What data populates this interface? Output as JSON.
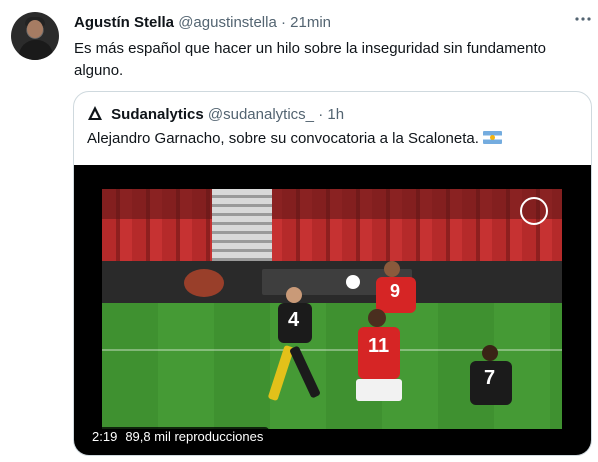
{
  "tweet": {
    "author_name": "Agustín Stella",
    "handle": "@agustinstella",
    "separator": "·",
    "time": "21min",
    "more_icon": "more-horizontal-icon",
    "text": "Es más español que hacer un hilo sobre la inseguridad sin fundamento alguno."
  },
  "quote": {
    "author_name": "Sudanalytics",
    "handle": "@sudanalytics_",
    "separator": "·",
    "time": "1h",
    "logo_icon": "triangle-logo-icon",
    "text": "Alejandro Garnacho, sobre su convocatoria a la Scaloneta.",
    "flag_icon": "argentina-flag-icon",
    "video": {
      "duration": "2:19",
      "views": "89,8 mil reproducciones",
      "jersey_numbers": [
        "4",
        "9",
        "11",
        "7"
      ]
    }
  },
  "colors": {
    "text_primary": "#0f1419",
    "text_secondary": "#536471",
    "border": "#cfd9de"
  }
}
